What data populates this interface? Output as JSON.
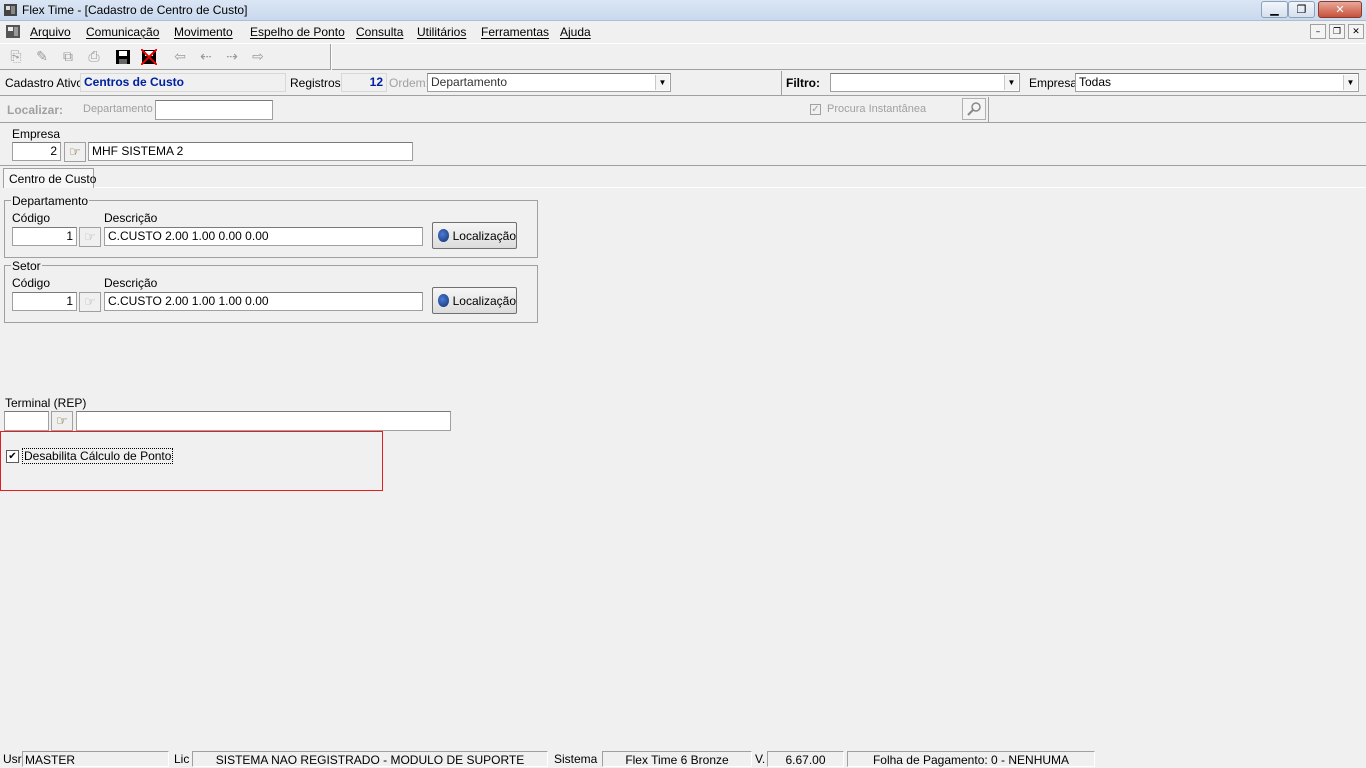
{
  "window": {
    "title": "Flex Time - [Cadastro de Centro de Custo]"
  },
  "menu": {
    "items": [
      "Arquivo",
      "Comunicação",
      "Movimento",
      "Espelho de Ponto",
      "Consulta",
      "Utilitários",
      "Ferramentas",
      "Ajuda"
    ]
  },
  "toolbar": {
    "icons": [
      "new-record-icon",
      "edit-record-icon",
      "copy-record-icon",
      "print-icon",
      "save-icon",
      "delete-icon",
      "first-record-icon",
      "previous-record-icon",
      "next-record-icon",
      "last-record-icon"
    ]
  },
  "header": {
    "cadastro_label": "Cadastro Ativo:",
    "cadastro_value": "Centros de Custo",
    "registros_label": "Registros:",
    "registros_value": "12",
    "ordem_label": "Ordem:",
    "ordem_value": "Departamento",
    "filtro_label": "Filtro:",
    "filtro_value": "",
    "empresa_label": "Empresa:",
    "empresa_value": "Todas"
  },
  "search": {
    "localizar_label": "Localizar:",
    "field_label": "Departamento",
    "value": "",
    "instant_label": "Procura Instantânea",
    "instant_checked": true
  },
  "empresa": {
    "label": "Empresa",
    "code": "2",
    "name": "MHF SISTEMA 2"
  },
  "tab": {
    "label": "Centro de Custo"
  },
  "departamento": {
    "legend": "Departamento",
    "codigo_label": "Código",
    "codigo_value": "1",
    "descricao_label": "Descrição",
    "descricao_value": "C.CUSTO 2.00  1.00  0.00  0.00",
    "button_label": "Localização"
  },
  "setor": {
    "legend": "Setor",
    "codigo_label": "Código",
    "codigo_value": "1",
    "descricao_label": "Descrição",
    "descricao_value": "C.CUSTO 2.00  1.00  1.00  0.00",
    "button_label": "Localização"
  },
  "terminal": {
    "label": "Terminal (REP)",
    "code": "",
    "name": ""
  },
  "options": {
    "disable_label": "Desabilita Cálculo de Ponto",
    "disable_checked": true
  },
  "status": {
    "usr_label": "Usr",
    "usr_value": "MASTER",
    "lic_label": "Lic",
    "lic_value": "SISTEMA NAO REGISTRADO - MODULO DE SUPORTE",
    "sistema_label": "Sistema",
    "sistema_value": "Flex Time 6 Bronze",
    "version_label": "V.",
    "version_value": "6.67.00",
    "folha_value": "Folha de Pagamento: 0 - NENHUMA"
  }
}
